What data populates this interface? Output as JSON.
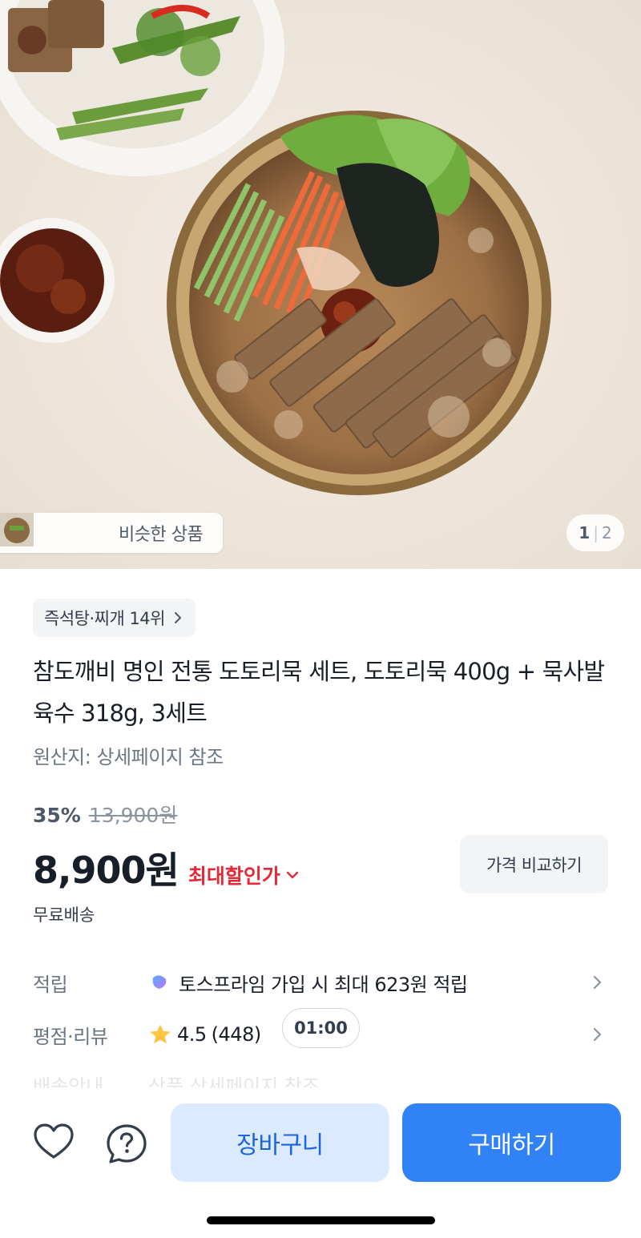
{
  "hero": {
    "similar_label": "비슷한 상품",
    "page_current": "1",
    "page_total": "2"
  },
  "product": {
    "rank_label": "즉석탕·찌개 14위",
    "title": "참도깨비 명인 전통 도토리묵 세트, 도토리묵 400g + 묵사발육수 318g, 3세트",
    "origin": "원산지: 상세페이지 참조",
    "discount_rate": "35%",
    "original_price": "13,900원",
    "price": "8,900원",
    "max_discount_label": "최대할인가",
    "compare_label": "가격 비교하기",
    "shipping": "무료배송"
  },
  "details": {
    "points_label": "적립",
    "points_value": "토스프라임 가입 시 최대 623원 적립",
    "rating_label": "평점·리뷰",
    "rating_value": "4.5",
    "review_count": "(448)",
    "timer": "01:00",
    "faded_row_label": "배송안내",
    "faded_row_value": "상품 상세페이지 참조"
  },
  "bottom": {
    "cart_label": "장바구니",
    "buy_label": "구매하기"
  },
  "colors": {
    "primary": "#3182f6",
    "cart_bg": "#dbeafe",
    "discount_red": "#e42939",
    "star": "#ffc342"
  }
}
